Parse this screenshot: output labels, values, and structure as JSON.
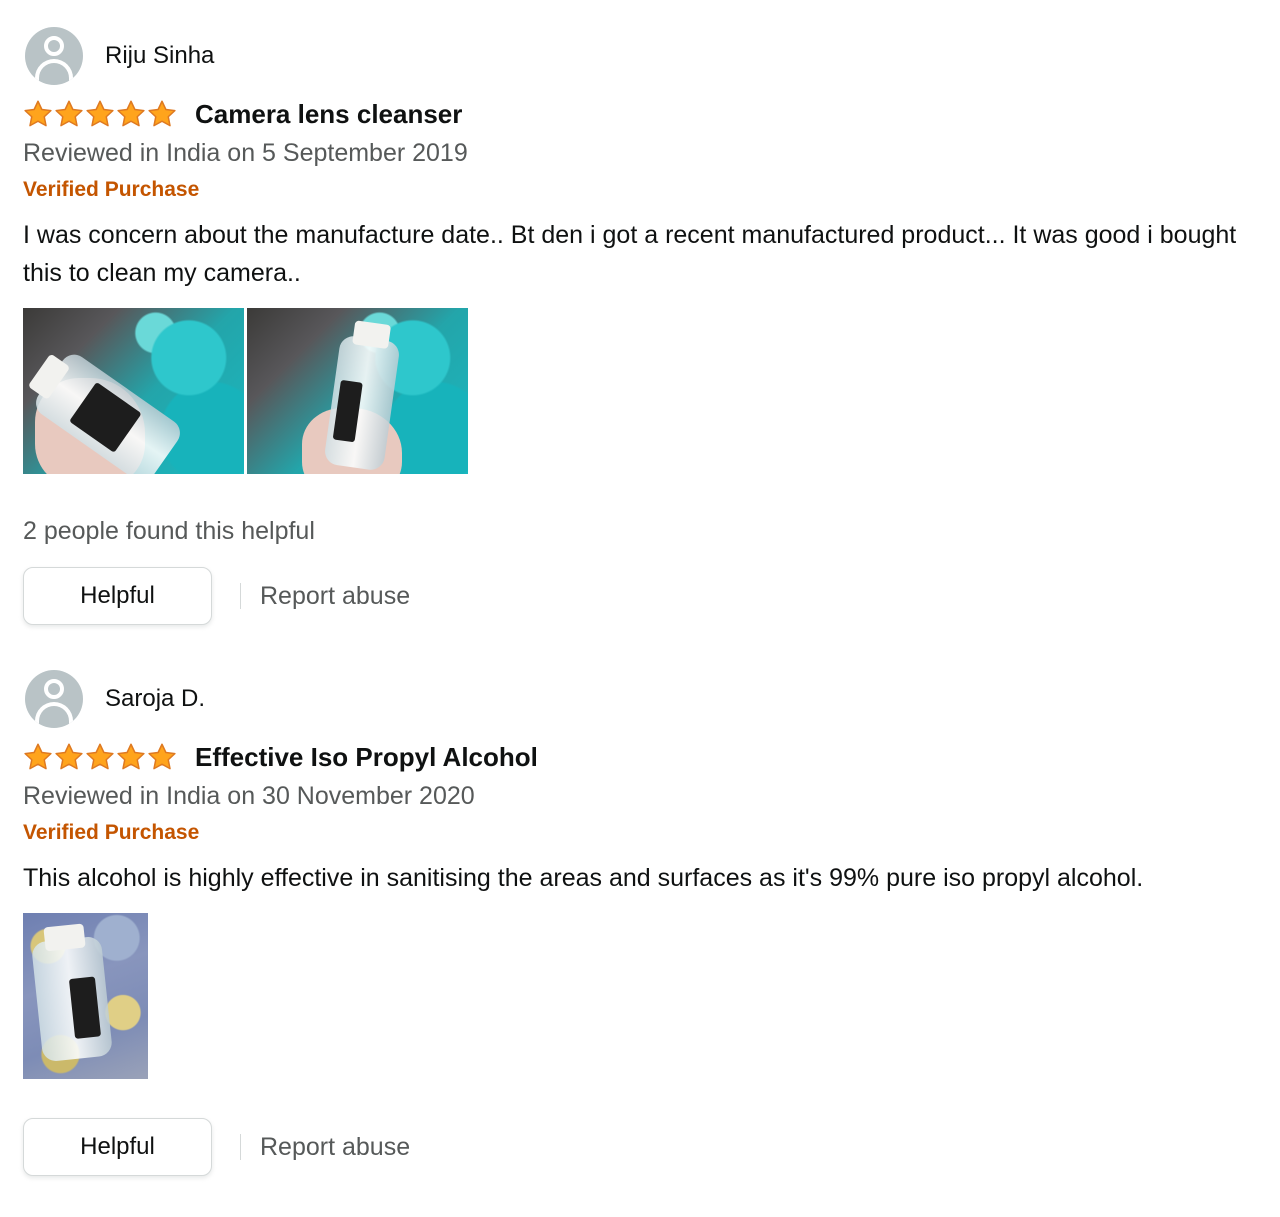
{
  "colors": {
    "star": "#ffa41c",
    "verified": "#c45500",
    "secondary_text": "#565959",
    "primary_text": "#0f1111"
  },
  "reviews": [
    {
      "profile_name": "Riju Sinha",
      "rating": 5,
      "title": "Camera lens cleanser",
      "date": "Reviewed in India on 5 September 2019",
      "verified": "Verified Purchase",
      "body": "I was concern about the manufacture date.. Bt den i got a recent manufactured product... It was good i bought this to clean my camera..",
      "image_count": 2,
      "helpful_count": "2 people found this helpful",
      "helpful_button": "Helpful",
      "report": "Report abuse"
    },
    {
      "profile_name": "Saroja D.",
      "rating": 5,
      "title": "Effective Iso Propyl Alcohol",
      "date": "Reviewed in India on 30 November 2020",
      "verified": "Verified Purchase",
      "body": "This alcohol is highly effective in sanitising the areas and surfaces as it's 99% pure iso propyl alcohol.",
      "image_count": 1,
      "helpful_button": "Helpful",
      "report": "Report abuse"
    }
  ]
}
